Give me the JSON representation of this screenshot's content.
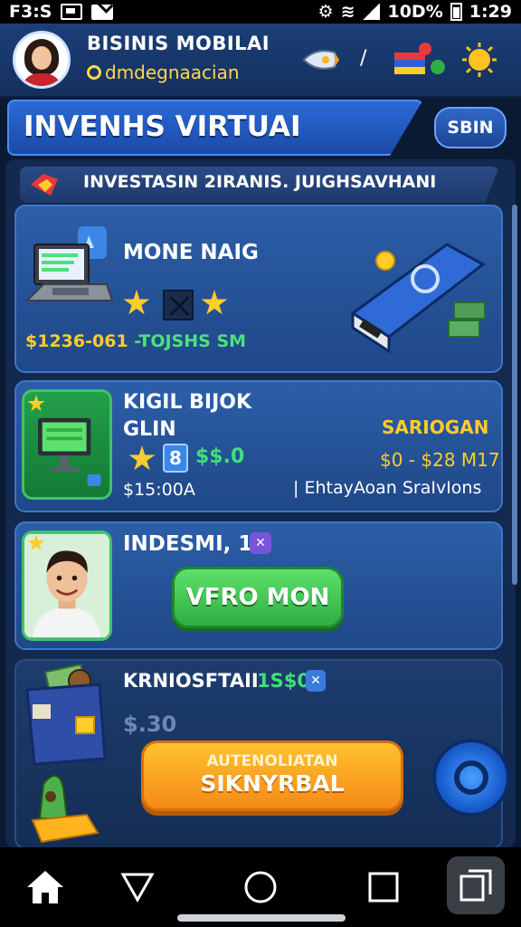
{
  "status_bar": {
    "left_text": "F3:S",
    "battery_text": "10D%",
    "time": "1:29"
  },
  "header": {
    "app_name": "BISINIS MOBILAI",
    "user_handle": "dmdegnaacian",
    "separator": "/"
  },
  "title_bar": {
    "title": "INVENHS VIRTUAI",
    "action_label": "SBIN"
  },
  "section": {
    "title": "INVESTASIN 2IRANIS. JUIGHSAVHANI"
  },
  "cards": [
    {
      "title": "MONE NAIG",
      "stats_price": "$1236-061",
      "stats_extra": "-TOJSHS SM",
      "stars": 2
    },
    {
      "title_line1": "KIGIL BIJOK",
      "title_line2": "GLIN",
      "level": "8",
      "reward": "$$.0",
      "price": "$15:00A",
      "status": "SARIOGAN",
      "range": "$0 - $28 M17",
      "desc": "| EhtayAoan SraIvIons"
    },
    {
      "title": "INDESMI, 10",
      "chip": "✕",
      "button_label": "VFRO MON"
    },
    {
      "title": "KRNIOSFTAII",
      "amount": "1S$0",
      "chip": "✕",
      "sub_value": "$.30",
      "cta_top": "AUTENOLIATAN",
      "cta_main": "SIKNYRBAL"
    }
  ],
  "colors": {
    "accent_blue": "#2a6ad6",
    "gold": "#ffcc2a",
    "green": "#3ee07a",
    "cta_orange": "#f58a18"
  }
}
